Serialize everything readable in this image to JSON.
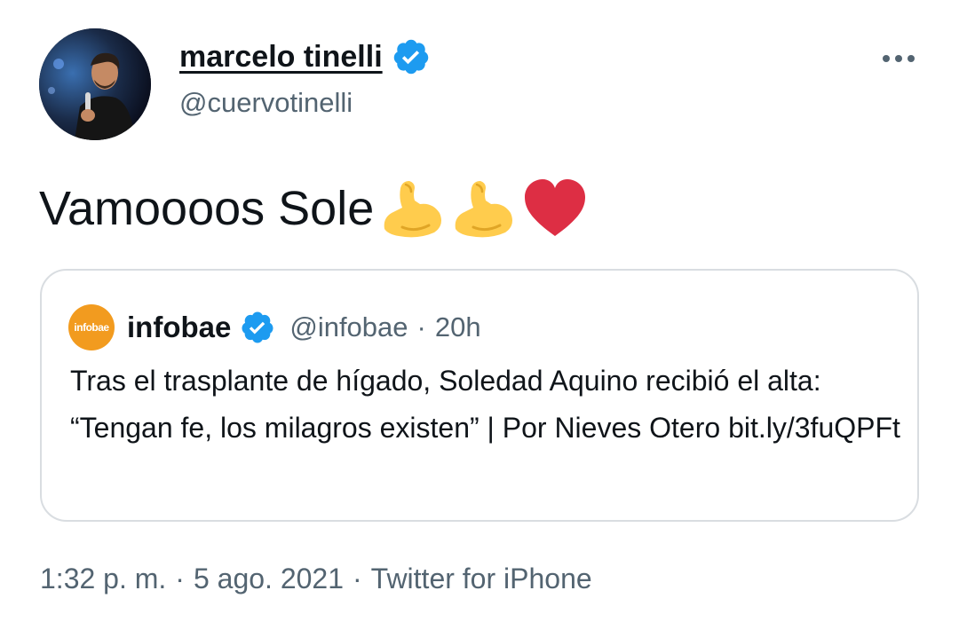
{
  "author": {
    "name": "marcelo tinelli",
    "handle": "@cuervotinelli",
    "verified": true,
    "avatar_icon": "profile-photo"
  },
  "more_icon": "ellipsis-icon",
  "tweet": {
    "text": "Vamoooos Sole",
    "emojis": [
      "flexed-biceps",
      "flexed-biceps",
      "red-heart"
    ]
  },
  "quote": {
    "name": "infobae",
    "logo_text": "infobae",
    "handle": "@infobae",
    "separator": "·",
    "time": "20h",
    "text": "Tras el trasplante de hígado, Soledad Aquino recibió el alta: “Tengan fe, los milagros existen” | Por Nieves Otero bit.ly/3fuQPFt",
    "verified": true
  },
  "meta": {
    "time": "1:32 p. m.",
    "separator1": "·",
    "date": "5 ago. 2021",
    "separator2": "·",
    "source": "Twitter for iPhone"
  },
  "colors": {
    "verified_blue": "#1d9bf0",
    "secondary_text": "#536471",
    "infobae_orange": "#f29b1f",
    "heart_red": "#dd2e44",
    "biceps_yellow": "#ffcc4d"
  }
}
